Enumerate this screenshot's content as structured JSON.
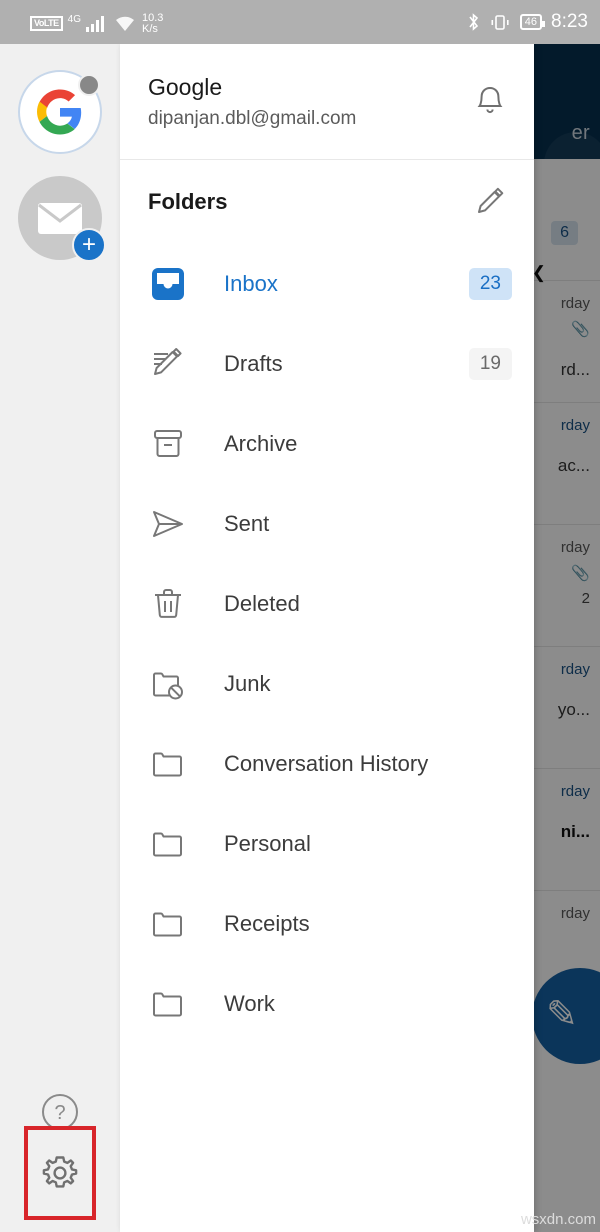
{
  "status_bar": {
    "volte_label": "VoLTE",
    "network": "4G",
    "data_speed_value": "10.3",
    "data_speed_unit": "K/s",
    "bluetooth_icon": "bluetooth-icon",
    "vibrate_icon": "vibrate-icon",
    "battery_level": "46",
    "time": "8:23",
    "bg_color": "#b0b0b0"
  },
  "rail": {
    "accounts": [
      {
        "name": "google-account-avatar",
        "letter": "G",
        "has_status_dot": true
      },
      {
        "name": "add-account-avatar",
        "icon": "envelope-icon",
        "badge_icon": "plus-icon"
      }
    ],
    "help_icon": "help-circle-icon",
    "settings_icon": "gear-icon",
    "settings_highlight_color": "#d8252a",
    "bg_color": "#f0f0f0"
  },
  "drawer": {
    "account": {
      "name": "Google",
      "email": "dipanjan.dbl@gmail.com",
      "notification_icon": "bell-icon"
    },
    "folders_header": {
      "title": "Folders",
      "edit_icon": "pencil-icon"
    },
    "folders": [
      {
        "label": "Inbox",
        "icon": "inbox-icon",
        "badge": "23",
        "badge_style": "blue",
        "active": true
      },
      {
        "label": "Drafts",
        "icon": "draft-pencil-icon",
        "badge": "19",
        "badge_style": "gray",
        "active": false
      },
      {
        "label": "Archive",
        "icon": "archive-icon",
        "badge": "",
        "badge_style": "",
        "active": false
      },
      {
        "label": "Sent",
        "icon": "send-icon",
        "badge": "",
        "badge_style": "",
        "active": false
      },
      {
        "label": "Deleted",
        "icon": "trash-icon",
        "badge": "",
        "badge_style": "",
        "active": false
      },
      {
        "label": "Junk",
        "icon": "folder-block-icon",
        "badge": "",
        "badge_style": "",
        "active": false
      },
      {
        "label": "Conversation History",
        "icon": "folder-icon",
        "badge": "",
        "badge_style": "",
        "active": false
      },
      {
        "label": "Personal",
        "icon": "folder-icon",
        "badge": "",
        "badge_style": "",
        "active": false
      },
      {
        "label": "Receipts",
        "icon": "folder-icon",
        "badge": "",
        "badge_style": "",
        "active": false
      },
      {
        "label": "Work",
        "icon": "folder-icon",
        "badge": "",
        "badge_style": "",
        "active": false
      }
    ],
    "accent_color": "#1a73c8"
  },
  "background_app": {
    "appbar_title_fragment": "er",
    "appbar_color": "#06304f",
    "unread_badge": "6",
    "rows": [
      {
        "date": "rday",
        "snippet": "rd...",
        "attachment": true,
        "count": ""
      },
      {
        "date": "rday",
        "snippet": "ac...",
        "attachment": false,
        "count": ""
      },
      {
        "date": "rday",
        "snippet": "yo...",
        "attachment": true,
        "count": "2"
      },
      {
        "date": "rday",
        "snippet": "ni...",
        "attachment": false,
        "count": ""
      },
      {
        "date": "rday",
        "snippet": "",
        "attachment": false,
        "count": ""
      }
    ],
    "fab_icon": "compose-icon"
  },
  "watermark": "wsxdn.com"
}
